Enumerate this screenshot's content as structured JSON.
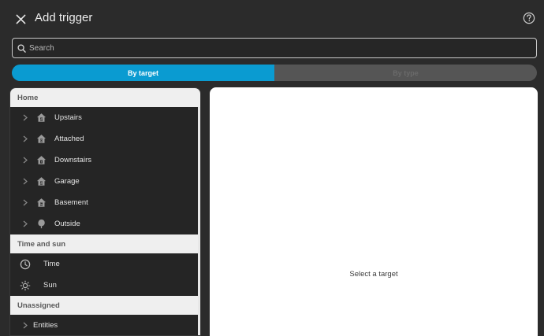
{
  "dialog": {
    "title": "Add trigger"
  },
  "search": {
    "placeholder": "Search"
  },
  "toggle": {
    "active_label": "By target",
    "inactive_label": "By type"
  },
  "sections": {
    "home": {
      "header": "Home",
      "items": [
        "Upstairs",
        "Attached",
        "Downstairs",
        "Garage",
        "Basement",
        "Outside"
      ]
    },
    "time": {
      "header": "Time and sun",
      "items": [
        "Time",
        "Sun"
      ]
    },
    "unassigned": {
      "header": "Unassigned",
      "items": [
        "Entities"
      ]
    }
  },
  "panel": {
    "empty_text": "Select a target"
  },
  "colors": {
    "accent": "#0a9bd1",
    "background": "#2b2b2b",
    "section_header": "#efefef"
  }
}
